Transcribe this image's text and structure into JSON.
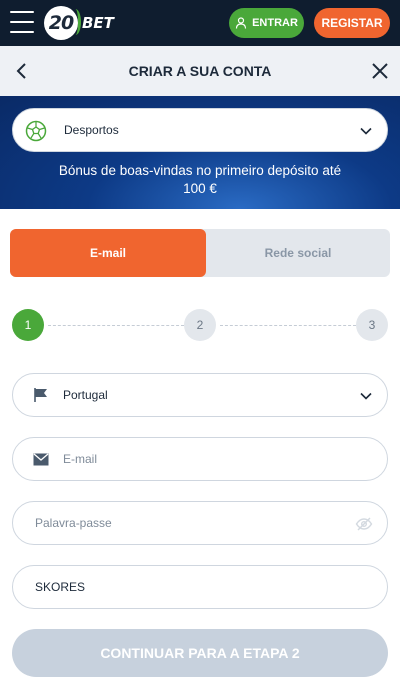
{
  "topbar": {
    "logo_number": "20",
    "logo_text": "BET",
    "login_label": "ENTRAR",
    "register_label": "REGISTAR",
    "colors": {
      "background": "#0f1d2f",
      "login": "#4aa83a",
      "register": "#f0652f"
    }
  },
  "header": {
    "title": "CRIAR A SUA CONTA"
  },
  "banner": {
    "sport_selected": "Desportos",
    "bonus_line1": "Bónus de boas-vindas no primeiro depósito até",
    "bonus_line2": "100 €"
  },
  "tabs": [
    {
      "label": "E-mail",
      "active": true
    },
    {
      "label": "Rede social",
      "active": false
    }
  ],
  "steps": [
    {
      "label": "1",
      "active": true
    },
    {
      "label": "2",
      "active": false
    },
    {
      "label": "3",
      "active": false
    }
  ],
  "form": {
    "country_value": "Portugal",
    "email_placeholder": "E-mail",
    "password_placeholder": "Palavra-passe",
    "promo_value": "SKORES"
  },
  "continue_label": "CONTINUAR PARA A ETAPA 2",
  "icons": {
    "menu": "hamburger-icon",
    "login": "user-icon",
    "back": "chevron-left-icon",
    "close": "close-icon",
    "sport": "soccer-ball-icon",
    "country": "flag-icon",
    "email": "envelope-icon",
    "password": "eye-off-icon"
  }
}
